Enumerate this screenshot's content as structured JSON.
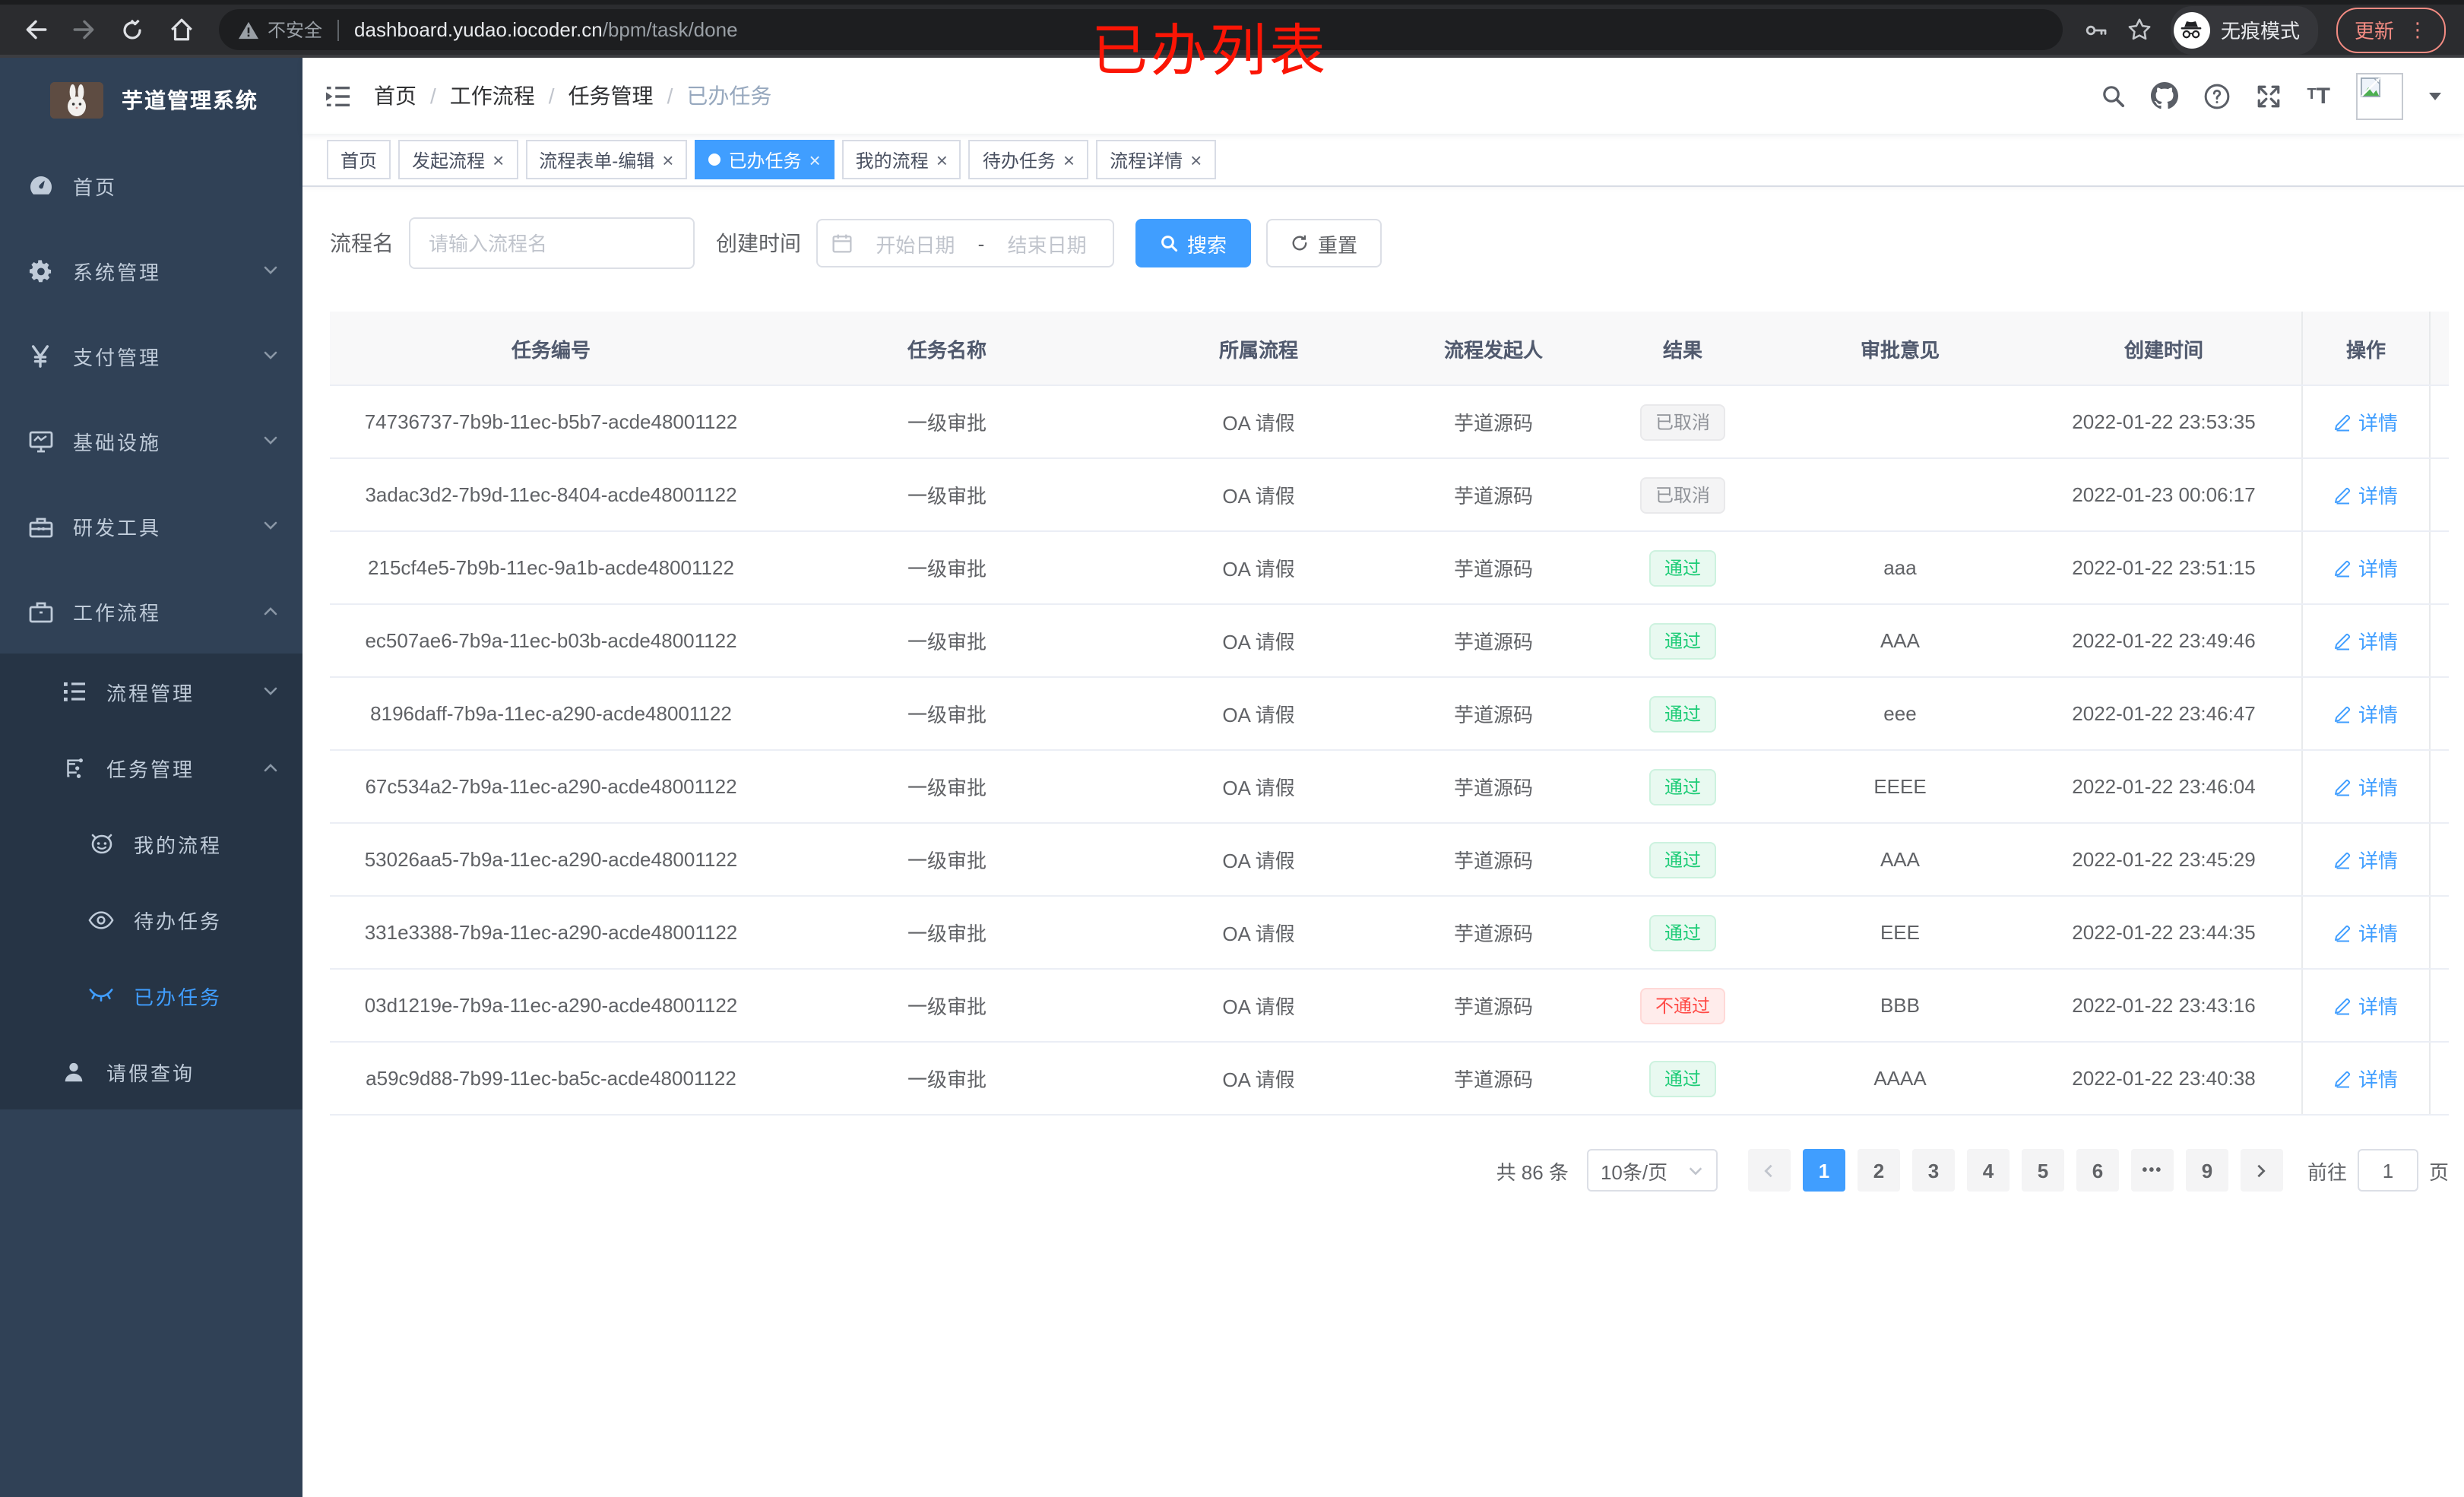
{
  "browser": {
    "security_label": "不安全",
    "url_host": "dashboard.yudao.iocoder.cn",
    "url_path": "/bpm/task/done",
    "incognito_label": "无痕模式",
    "update_label": "更新",
    "menu_dots": "⋮"
  },
  "annotation": "已办列表",
  "sidebar": {
    "title": "芋道管理系统",
    "menu": [
      {
        "key": "home",
        "label": "首页",
        "icon": "dashboard-icon",
        "level": 1
      },
      {
        "key": "system",
        "label": "系统管理",
        "icon": "gear-icon",
        "level": 1,
        "chevron": "down"
      },
      {
        "key": "payment",
        "label": "支付管理",
        "icon": "yen-icon",
        "level": 1,
        "chevron": "down"
      },
      {
        "key": "infra",
        "label": "基础设施",
        "icon": "monitor-icon",
        "level": 1,
        "chevron": "down"
      },
      {
        "key": "devtools",
        "label": "研发工具",
        "icon": "toolbox-icon",
        "level": 1,
        "chevron": "down"
      },
      {
        "key": "workflow",
        "label": "工作流程",
        "icon": "briefcase-icon",
        "level": 1,
        "chevron": "up"
      },
      {
        "key": "process-mgmt",
        "label": "流程管理",
        "icon": "tree-icon",
        "level": 2,
        "chevron": "down",
        "sub": true
      },
      {
        "key": "task-mgmt",
        "label": "任务管理",
        "icon": "share-icon",
        "level": 2,
        "chevron": "up",
        "sub": true
      },
      {
        "key": "my-process",
        "label": "我的流程",
        "icon": "face-icon",
        "level": 3,
        "sub": true
      },
      {
        "key": "todo-tasks",
        "label": "待办任务",
        "icon": "eye-icon",
        "level": 3,
        "sub": true
      },
      {
        "key": "done-tasks",
        "label": "已办任务",
        "icon": "eye-closed-icon",
        "level": 3,
        "sub": true,
        "active": true
      },
      {
        "key": "leave-query",
        "label": "请假查询",
        "icon": "user-icon",
        "level": 2,
        "sub": true
      }
    ]
  },
  "breadcrumb": [
    "首页",
    "工作流程",
    "任务管理",
    "已办任务"
  ],
  "tabs": [
    {
      "key": "home",
      "label": "首页",
      "closable": false,
      "active": false
    },
    {
      "key": "start-process",
      "label": "发起流程",
      "closable": true,
      "active": false
    },
    {
      "key": "form-edit",
      "label": "流程表单-编辑",
      "closable": true,
      "active": false
    },
    {
      "key": "done-tasks",
      "label": "已办任务",
      "closable": true,
      "active": true
    },
    {
      "key": "my-process",
      "label": "我的流程",
      "closable": true,
      "active": false
    },
    {
      "key": "todo-tasks",
      "label": "待办任务",
      "closable": true,
      "active": false
    },
    {
      "key": "process-detail",
      "label": "流程详情",
      "closable": true,
      "active": false
    }
  ],
  "filters": {
    "name_label": "流程名",
    "name_placeholder": "请输入流程名",
    "time_label": "创建时间",
    "start_placeholder": "开始日期",
    "range_separator": "-",
    "end_placeholder": "结束日期",
    "search_label": "搜索",
    "reset_label": "重置"
  },
  "table": {
    "columns": [
      "任务编号",
      "任务名称",
      "所属流程",
      "流程发起人",
      "结果",
      "审批意见",
      "创建时间",
      "操作"
    ],
    "action_label": "详情",
    "rows": [
      {
        "id": "74736737-7b9b-11ec-b5b7-acde48001122",
        "name": "一级审批",
        "process": "OA 请假",
        "starter": "芋道源码",
        "result": "已取消",
        "result_type": "info",
        "opinion": "",
        "created": "2022-01-22 23:53:35"
      },
      {
        "id": "3adac3d2-7b9d-11ec-8404-acde48001122",
        "name": "一级审批",
        "process": "OA 请假",
        "starter": "芋道源码",
        "result": "已取消",
        "result_type": "info",
        "opinion": "",
        "created": "2022-01-23 00:06:17"
      },
      {
        "id": "215cf4e5-7b9b-11ec-9a1b-acde48001122",
        "name": "一级审批",
        "process": "OA 请假",
        "starter": "芋道源码",
        "result": "通过",
        "result_type": "success",
        "opinion": "aaa",
        "created": "2022-01-22 23:51:15"
      },
      {
        "id": "ec507ae6-7b9a-11ec-b03b-acde48001122",
        "name": "一级审批",
        "process": "OA 请假",
        "starter": "芋道源码",
        "result": "通过",
        "result_type": "success",
        "opinion": "AAA",
        "created": "2022-01-22 23:49:46"
      },
      {
        "id": "8196daff-7b9a-11ec-a290-acde48001122",
        "name": "一级审批",
        "process": "OA 请假",
        "starter": "芋道源码",
        "result": "通过",
        "result_type": "success",
        "opinion": "eee",
        "created": "2022-01-22 23:46:47"
      },
      {
        "id": "67c534a2-7b9a-11ec-a290-acde48001122",
        "name": "一级审批",
        "process": "OA 请假",
        "starter": "芋道源码",
        "result": "通过",
        "result_type": "success",
        "opinion": "EEEE",
        "created": "2022-01-22 23:46:04"
      },
      {
        "id": "53026aa5-7b9a-11ec-a290-acde48001122",
        "name": "一级审批",
        "process": "OA 请假",
        "starter": "芋道源码",
        "result": "通过",
        "result_type": "success",
        "opinion": "AAA",
        "created": "2022-01-22 23:45:29"
      },
      {
        "id": "331e3388-7b9a-11ec-a290-acde48001122",
        "name": "一级审批",
        "process": "OA 请假",
        "starter": "芋道源码",
        "result": "通过",
        "result_type": "success",
        "opinion": "EEE",
        "created": "2022-01-22 23:44:35"
      },
      {
        "id": "03d1219e-7b9a-11ec-a290-acde48001122",
        "name": "一级审批",
        "process": "OA 请假",
        "starter": "芋道源码",
        "result": "不通过",
        "result_type": "danger",
        "opinion": "BBB",
        "created": "2022-01-22 23:43:16"
      },
      {
        "id": "a59c9d88-7b99-11ec-ba5c-acde48001122",
        "name": "一级审批",
        "process": "OA 请假",
        "starter": "芋道源码",
        "result": "通过",
        "result_type": "success",
        "opinion": "AAAA",
        "created": "2022-01-22 23:40:38"
      }
    ]
  },
  "pagination": {
    "total_text": "共 86 条",
    "page_size": "10条/页",
    "pages": [
      "1",
      "2",
      "3",
      "4",
      "5",
      "6",
      "•••",
      "9"
    ],
    "active_page": "1",
    "goto_label": "前往",
    "goto_value": "1",
    "goto_suffix": "页"
  },
  "colors": {
    "accent": "#409eff",
    "sidebar_bg": "#304156",
    "submenu_bg": "#263445",
    "success": "#1ecc77",
    "danger": "#ff4b47",
    "info": "#909399",
    "annotation_red": "#fb1505"
  }
}
